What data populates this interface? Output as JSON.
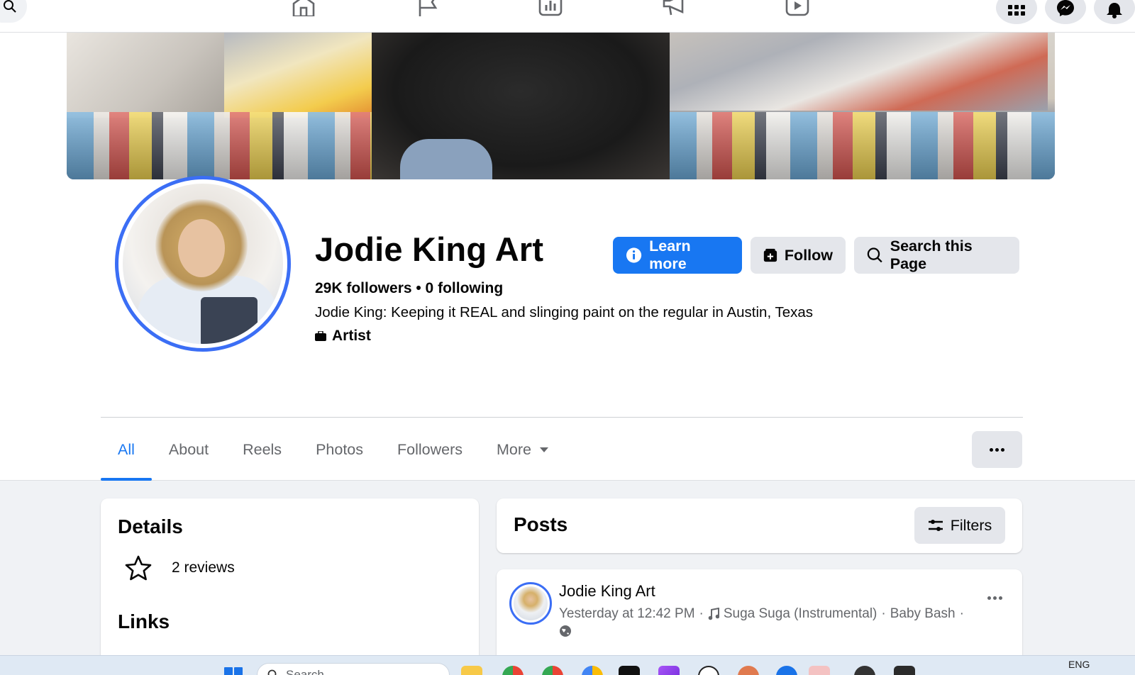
{
  "nav": {
    "icons": [
      "home-icon",
      "flag-icon",
      "chart-icon",
      "megaphone-icon",
      "video-icon"
    ],
    "right_icons": [
      "menu-grid-icon",
      "messenger-icon",
      "bell-icon"
    ]
  },
  "page": {
    "name": "Jodie King Art",
    "followers_line": "29K followers • 0 following",
    "bio": "Jodie King: Keeping it REAL and slinging paint on the regular in Austin, Texas",
    "category": "Artist"
  },
  "actions": {
    "learn_more": "Learn more",
    "follow": "Follow",
    "search_page": "Search this Page"
  },
  "tabs": [
    {
      "label": "All",
      "active": true
    },
    {
      "label": "About"
    },
    {
      "label": "Reels"
    },
    {
      "label": "Photos"
    },
    {
      "label": "Followers"
    },
    {
      "label": "More"
    }
  ],
  "details": {
    "title": "Details",
    "reviews": "2 reviews",
    "links_title": "Links"
  },
  "posts": {
    "title": "Posts",
    "filters": "Filters",
    "first_post": {
      "author": "Jodie King Art",
      "time": "Yesterday at 12:42 PM",
      "sep1": "·",
      "song": "Suga Suga (Instrumental)",
      "sep2": "·",
      "artist": "Baby Bash",
      "sep3": "·"
    }
  },
  "taskbar": {
    "search_placeholder": "Search",
    "language": "ENG"
  },
  "colors": {
    "accent": "#1877f2",
    "avatar_ring": "#3b6ef5",
    "secondary_button": "#e4e6eb"
  }
}
